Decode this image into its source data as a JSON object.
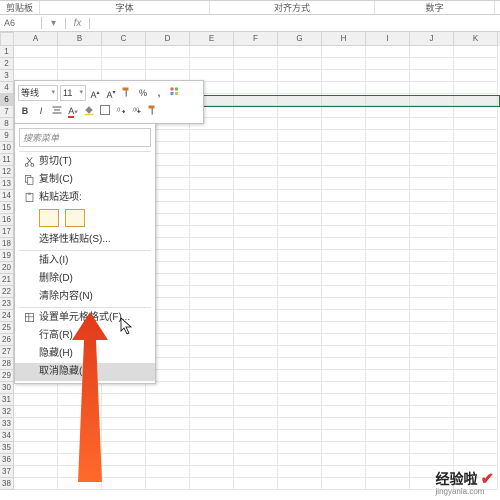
{
  "ribbon_groups": {
    "clipboard": "剪贴板",
    "font": "字体",
    "alignment": "对齐方式",
    "number": "数字"
  },
  "namebox": {
    "value": "A6"
  },
  "columns": [
    "A",
    "B",
    "C",
    "D",
    "E",
    "F",
    "G",
    "H",
    "I",
    "J",
    "K"
  ],
  "rows": [
    1,
    2,
    3,
    4,
    6,
    7,
    8,
    9,
    10,
    11,
    12,
    13,
    14,
    15,
    16,
    17,
    18,
    19,
    20,
    21,
    22,
    23,
    24,
    25,
    26,
    27,
    28,
    29,
    30,
    31,
    32,
    33,
    34,
    35,
    36,
    37,
    38
  ],
  "selected_row_index": 4,
  "mini_toolbar": {
    "font_name": "等线",
    "font_size": "11",
    "bold": "B",
    "italic": "I"
  },
  "context_menu": {
    "search_placeholder": "搜索菜单",
    "cut": "剪切(T)",
    "copy": "复制(C)",
    "paste_label": "粘贴选项:",
    "paste_special": "选择性粘贴(S)...",
    "insert": "插入(I)",
    "delete": "删除(D)",
    "clear": "清除内容(N)",
    "format_cells": "设置单元格格式(F)...",
    "row_height": "行高(R)...",
    "hide": "隐藏(H)",
    "unhide": "取消隐藏(U)"
  },
  "watermark": {
    "brand": "经验啦",
    "url": "jingyanla.com"
  }
}
